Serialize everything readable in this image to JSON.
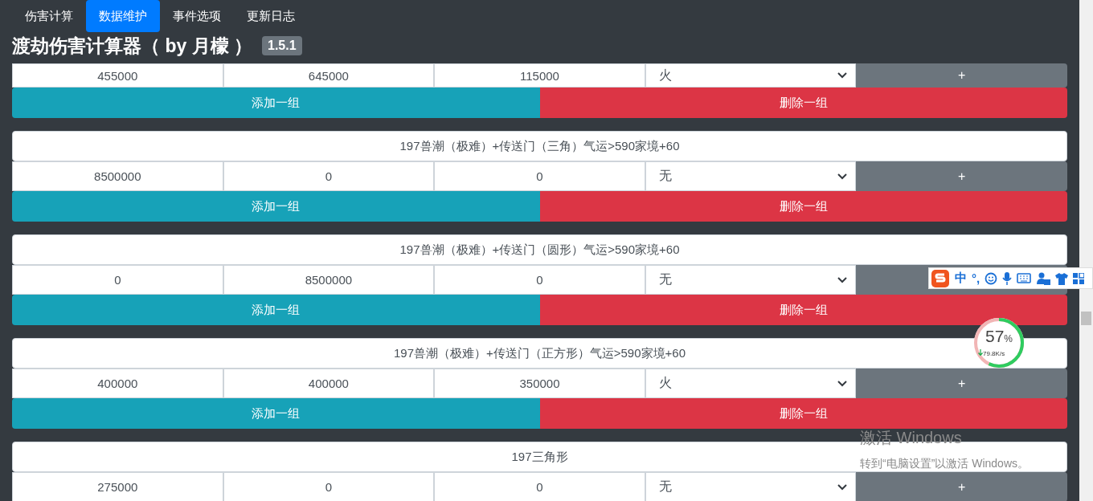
{
  "nav": {
    "tabs": [
      {
        "label": "伤害计算",
        "selected": false
      },
      {
        "label": "数据维护",
        "selected": true
      },
      {
        "label": "事件选项",
        "selected": false
      },
      {
        "label": "更新日志",
        "selected": false
      }
    ]
  },
  "title": "渡劫伤害计算器（ by 月檬 ）",
  "version": "1.5.1",
  "groups": [
    {
      "values": [
        "455000",
        "645000",
        "115000"
      ],
      "element": "火",
      "plus": "+",
      "add_button": "添加一组",
      "delete_button": "删除一组"
    },
    {
      "name": "197兽潮（极难）+传送门（三角）气运>590家境+60",
      "values": [
        "8500000",
        "0",
        "0"
      ],
      "element": "无",
      "plus": "+",
      "add_button": "添加一组",
      "delete_button": "删除一组"
    },
    {
      "name": "197兽潮（极难）+传送门（圆形）气运>590家境+60",
      "values": [
        "0",
        "8500000",
        "0"
      ],
      "element": "无",
      "add_button": "添加一组",
      "delete_button": "删除一组"
    },
    {
      "name": "197兽潮（极难）+传送门（正方形）气运>590家境+60",
      "values": [
        "400000",
        "400000",
        "350000"
      ],
      "element": "火",
      "plus": "+",
      "add_button": "添加一组",
      "delete_button": "删除一组"
    },
    {
      "name": "197三角形",
      "values": [
        "275000",
        "0",
        "0"
      ],
      "element": "无",
      "plus": "+"
    }
  ],
  "ime_toolbar": {
    "mode": "中",
    "punctuation": "°,"
  },
  "net_monitor": {
    "percent": "57",
    "unit": "%",
    "speed": "79.8K/s",
    "level": 0.57
  },
  "activation": {
    "title": "激活 Windows",
    "hint": "转到“电脑设置”以激活 Windows。"
  }
}
